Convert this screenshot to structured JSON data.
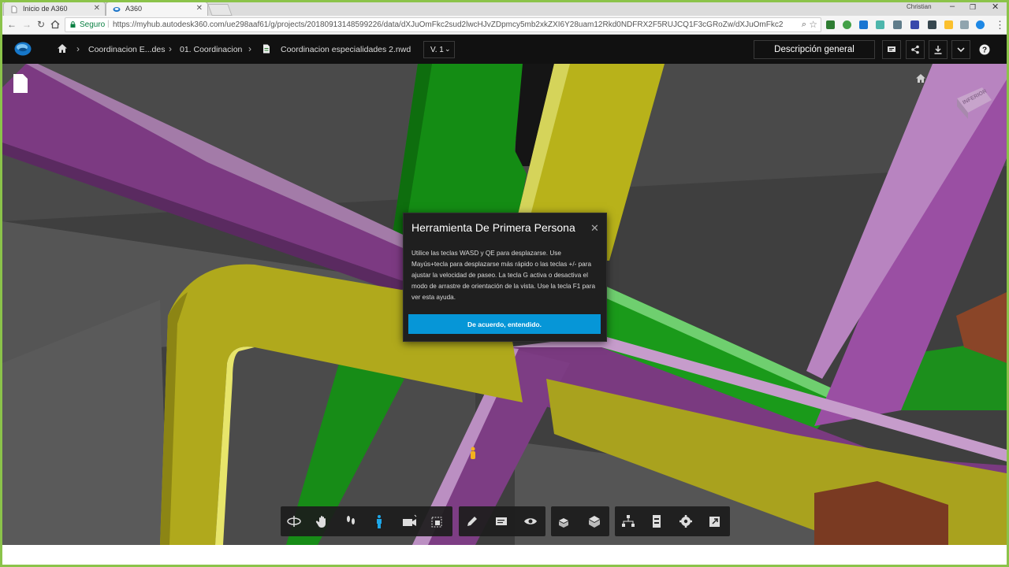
{
  "browser": {
    "tabs": [
      {
        "title": "Inicio de A360",
        "active": false
      },
      {
        "title": "A360",
        "active": true
      }
    ],
    "profile_name": "Christian",
    "secure_label": "Seguro",
    "url": "https://myhub.autodesk360.com/ue298aaf61/g/projects/20180913148599226/data/dXJuOmFkc2sud2lwcHJvZDpmcy5mb2xkZXI6Y28uam12Rkd0NDFRX2F5RUJCQ1F3cGRoZw/dXJuOmFkc2sud2lwcHJvZDpkbS"
  },
  "app": {
    "breadcrumbs": [
      "Coordinacion E...des",
      "01. Coordinacion",
      "Coordinacion especialidades 2.nwd"
    ],
    "version_label": "V. 1",
    "overview_label": "Descripción general"
  },
  "viewer": {
    "viewcube_face": "INFERIOR"
  },
  "dialog": {
    "title": "Herramienta De Primera Persona",
    "body": "Utilice las teclas WASD y QE para desplazarse. Use Mayús+tecla para desplazarse más rápido o las teclas +/- para ajustar la velocidad de paseo. La tecla G activa o desactiva el modo de arrastre de orientación de la vista. Use la tecla F1 para ver esta ayuda.",
    "ok_label": "De acuerdo, entendido."
  },
  "toolbar": {
    "groups": [
      [
        "orbit-icon",
        "pan-icon",
        "walk-footprints-icon",
        "first-person-icon",
        "camera-icon",
        "fit-view-icon"
      ],
      [
        "markup-pencil-icon",
        "comment-icon",
        "view-eye-icon"
      ],
      [
        "explode-icon",
        "section-cube-icon"
      ],
      [
        "model-browser-icon",
        "properties-icon",
        "settings-icon",
        "fullscreen-icon"
      ]
    ],
    "active": "first-person-icon"
  },
  "colors": {
    "purple": "#8e3f92",
    "yellow": "#b8b01e",
    "green": "#1e8f1e",
    "accent": "#0696d7",
    "frame": "#8bc34a"
  }
}
